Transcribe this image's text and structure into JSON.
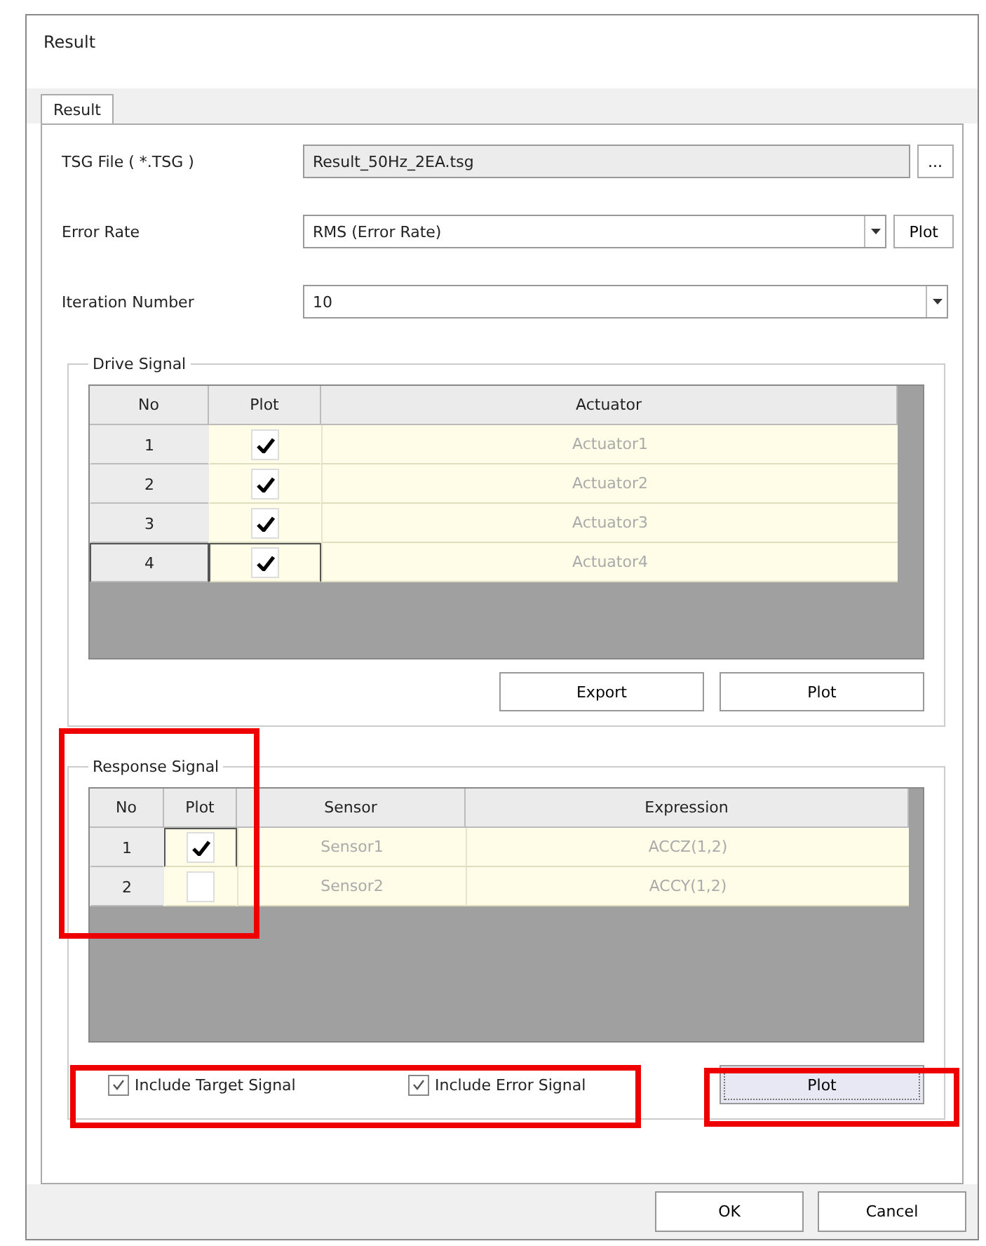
{
  "window": {
    "title": "Result"
  },
  "tabs": [
    {
      "label": "Result",
      "selected": true
    }
  ],
  "fields": [
    {
      "kind": "file",
      "label": "TSG File ( *.TSG )",
      "value": "Result_50Hz_2EA.tsg",
      "button": "..."
    },
    {
      "kind": "combo_button",
      "label": "Error Rate",
      "value": "RMS (Error Rate)",
      "button": "Plot"
    },
    {
      "kind": "combo",
      "label": "Iteration Number",
      "value": "10"
    }
  ],
  "drive_signal": {
    "title": "Drive Signal",
    "columns": [
      "No",
      "Plot",
      "Actuator"
    ],
    "rows": [
      {
        "no": "1",
        "checked": true,
        "name": "Actuator1",
        "selected": false
      },
      {
        "no": "2",
        "checked": true,
        "name": "Actuator2",
        "selected": false
      },
      {
        "no": "3",
        "checked": true,
        "name": "Actuator3",
        "selected": false
      },
      {
        "no": "4",
        "checked": true,
        "name": "Actuator4",
        "selected": true
      }
    ],
    "buttons": [
      "Export",
      "Plot"
    ]
  },
  "response_signal": {
    "title": "Response Signal",
    "highlighted": true,
    "columns": [
      "No",
      "Plot",
      "Sensor",
      "Expression"
    ],
    "rows": [
      {
        "no": "1",
        "checked": true,
        "sensor": "Sensor1",
        "expression": "ACCZ(1,2)",
        "selected": true
      },
      {
        "no": "2",
        "checked": false,
        "sensor": "Sensor2",
        "expression": "ACCY(1,2)",
        "selected": false
      }
    ],
    "options": [
      {
        "label": "Include Target Signal",
        "checked": true
      },
      {
        "label": "Include Error Signal",
        "checked": true
      }
    ],
    "options_highlighted": true,
    "plot_button": {
      "label": "Plot",
      "focused": true,
      "highlighted": true
    }
  },
  "buttons": [
    "OK",
    "Cancel"
  ]
}
